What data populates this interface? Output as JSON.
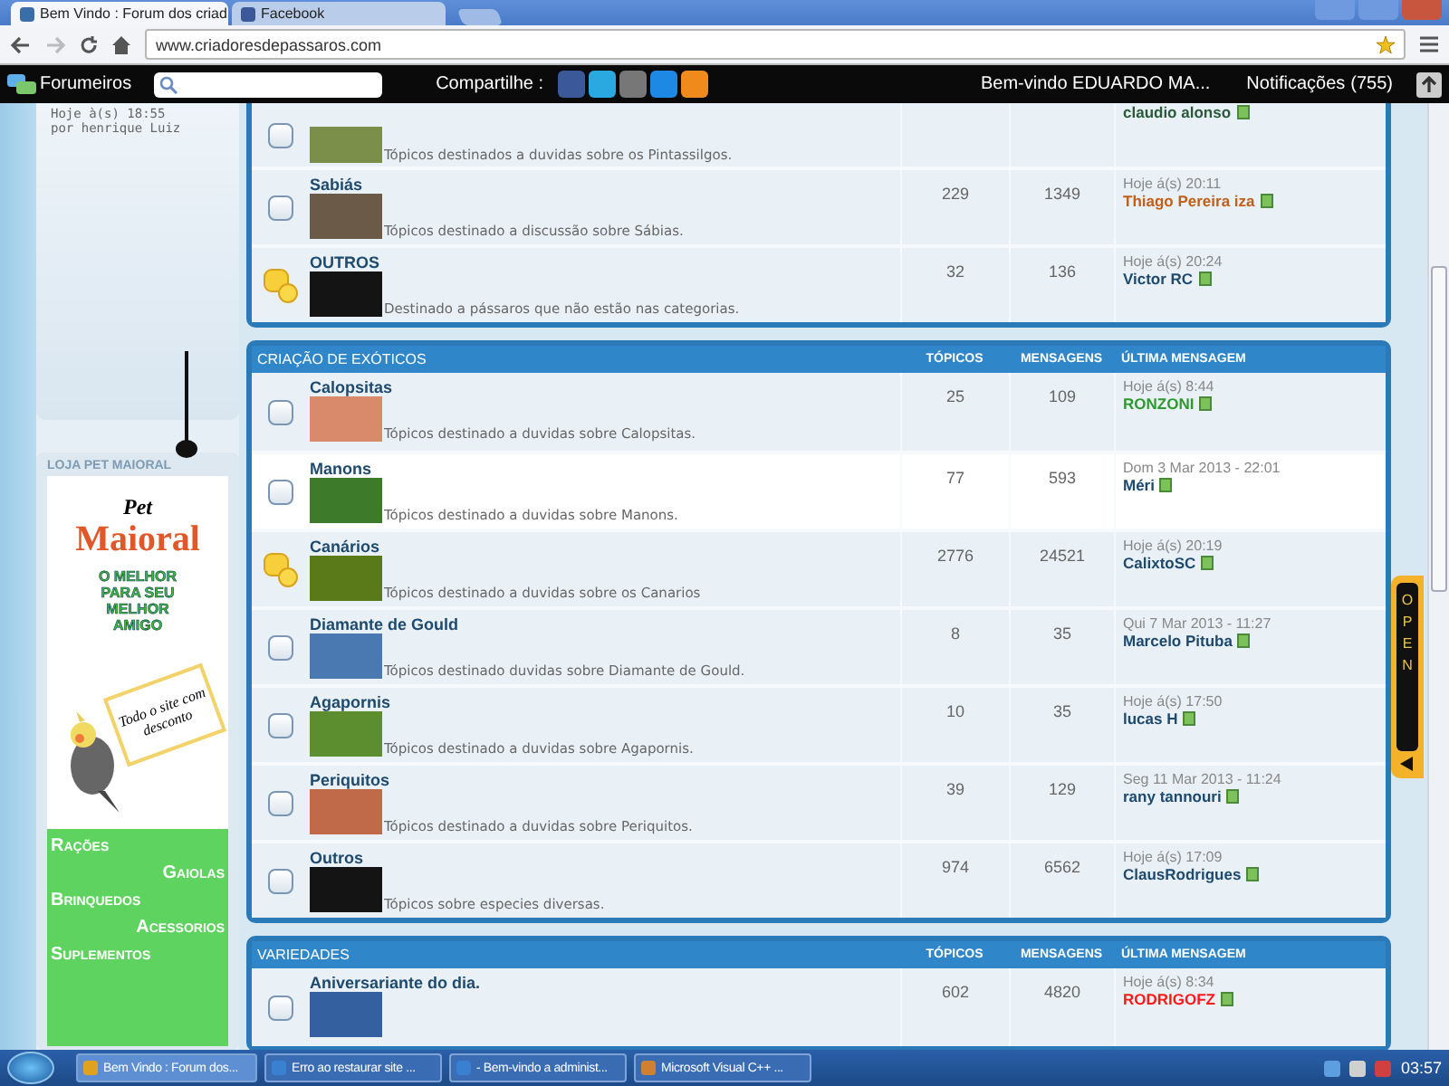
{
  "browser": {
    "tabs": [
      {
        "title": "Bem Vindo : Forum dos criad",
        "selected": true
      },
      {
        "title": "Facebook",
        "selected": false
      }
    ],
    "address": "www.criadoresdepassaros.com"
  },
  "toolbar": {
    "brand": "Forumeiros",
    "share_label": "Compartilhe :",
    "welcome": "Bem-vindo EDUARDO MA...",
    "notifications_label": "Notificações",
    "notifications_count": "(755)"
  },
  "sidebar": {
    "last_post": {
      "time": "Hoje à(s) 18:55",
      "author": "por henrique Luiz"
    },
    "ad": {
      "title": "LOJA PET MAIORAL",
      "brand_top": "Pet",
      "brand": "Maioral",
      "slogan": "O MELHOR PARA SEU MELHOR AMIGO",
      "badge": "Todo o site com desconto",
      "products": [
        "Rações",
        "Gaiolas",
        "Brinquedos",
        "Acessorios",
        "Suplementos"
      ]
    }
  },
  "sections": [
    {
      "forums": [
        {
          "kind": "partial",
          "description": "Tópicos destinados a duvidas sobre os Pintassilgos.",
          "last_author": "claudio alonso",
          "color": "#2a5a3a",
          "unread": false,
          "highlighted": false
        },
        {
          "kind": "full",
          "name": "Sabiás",
          "description": "Tópicos destinado a discussão sobre Sábias.",
          "topics": "229",
          "posts": "1349",
          "last_time": "Hoje á(s) 20:11",
          "last_author": "Thiago Pereira iza",
          "color": "#c0601a",
          "unread": false,
          "highlighted": false
        },
        {
          "kind": "full",
          "name": "OUTROS",
          "description": "Destinado a pássaros que não estão nas categorias.",
          "topics": "32",
          "posts": "136",
          "last_time": "Hoje á(s) 20:24",
          "last_author": "Victor RC",
          "color": "#1e4a6e",
          "unread": true,
          "highlighted": false
        }
      ]
    },
    {
      "title": "CRIAÇÃO DE EXÓTICOS",
      "columns": [
        "TÓPICOS",
        "MENSAGENS",
        "ÚLTIMA MENSAGEM"
      ],
      "forums": [
        {
          "kind": "full",
          "name": "Calopsitas",
          "description": "Tópicos destinado a duvidas sobre Calopsitas.",
          "topics": "25",
          "posts": "109",
          "last_time": "Hoje á(s) 8:44",
          "last_author": "RONZONI",
          "color": "#2e9a2e",
          "unread": false,
          "highlighted": false
        },
        {
          "kind": "full",
          "name": "Manons",
          "description": "Tópicos destinado a duvidas sobre Manons.",
          "topics": "77",
          "posts": "593",
          "last_time": "Dom 3 Mar 2013 - 22:01",
          "last_author": "Méri",
          "color": "#1e4a6e",
          "unread": false,
          "highlighted": true
        },
        {
          "kind": "full",
          "name": "Canários",
          "description": "Tópicos destinado a duvidas sobre os Canarios",
          "topics": "2776",
          "posts": "24521",
          "last_time": "Hoje á(s) 20:19",
          "last_author": "CalixtoSC",
          "color": "#1e4a6e",
          "unread": true,
          "highlighted": false
        },
        {
          "kind": "full",
          "name": "Diamante de Gould",
          "description": "Tópicos destinado duvidas sobre Diamante de Gould.",
          "topics": "8",
          "posts": "35",
          "last_time": "Qui 7 Mar 2013 - 11:27",
          "last_author": "Marcelo Pituba",
          "color": "#1e4a6e",
          "unread": false,
          "highlighted": false
        },
        {
          "kind": "full",
          "name": "Agapornis",
          "description": "Tópicos destinado a duvidas sobre Agapornis.",
          "topics": "10",
          "posts": "35",
          "last_time": "Hoje á(s) 17:50",
          "last_author": "lucas H",
          "color": "#1e4a6e",
          "unread": false,
          "highlighted": false
        },
        {
          "kind": "full",
          "name": "Periquitos",
          "description": "Tópicos destinado a duvidas sobre Periquitos.",
          "topics": "39",
          "posts": "129",
          "last_time": "Seg 11 Mar 2013 - 11:24",
          "last_author": "rany tannouri",
          "color": "#1e4a6e",
          "unread": false,
          "highlighted": false
        },
        {
          "kind": "full",
          "name": "Outros",
          "description": "Tópicos sobre especies diversas.",
          "topics": "974",
          "posts": "6562",
          "last_time": "Hoje á(s) 17:09",
          "last_author": "ClausRodrigues",
          "color": "#1e4a6e",
          "unread": false,
          "highlighted": false
        }
      ]
    },
    {
      "title": "VARIEDADES",
      "columns": [
        "TÓPICOS",
        "MENSAGENS",
        "ÚLTIMA MENSAGEM"
      ],
      "forums": [
        {
          "kind": "full",
          "name": "Aniversariante do dia.",
          "topics": "602",
          "posts": "4820",
          "last_time": "Hoje á(s) 8:34",
          "last_author": "RODRIGOFZ",
          "color": "#ff1a1a",
          "unread": false,
          "highlighted": false
        }
      ]
    }
  ],
  "open_tab": "OPEN",
  "taskbar": {
    "items": [
      {
        "label": "Bem Vindo : Forum dos...",
        "selected": true
      },
      {
        "label": "Erro ao restaurar site ...",
        "selected": false
      },
      {
        "label": "- Bem-vindo a administ...",
        "selected": false
      },
      {
        "label": "Microsoft Visual C++ ...",
        "selected": false
      }
    ],
    "time": "03:57"
  }
}
